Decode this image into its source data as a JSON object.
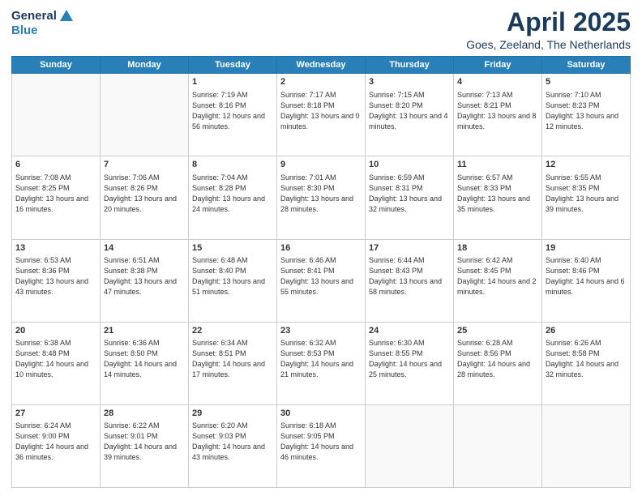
{
  "header": {
    "logo_general": "General",
    "logo_blue": "Blue",
    "title": "April 2025",
    "location": "Goes, Zeeland, The Netherlands"
  },
  "weekdays": [
    "Sunday",
    "Monday",
    "Tuesday",
    "Wednesday",
    "Thursday",
    "Friday",
    "Saturday"
  ],
  "weeks": [
    [
      {
        "day": "",
        "sunrise": "",
        "sunset": "",
        "daylight": "",
        "empty": true
      },
      {
        "day": "",
        "sunrise": "",
        "sunset": "",
        "daylight": "",
        "empty": true
      },
      {
        "day": "1",
        "sunrise": "Sunrise: 7:19 AM",
        "sunset": "Sunset: 8:16 PM",
        "daylight": "Daylight: 12 hours and 56 minutes.",
        "empty": false
      },
      {
        "day": "2",
        "sunrise": "Sunrise: 7:17 AM",
        "sunset": "Sunset: 8:18 PM",
        "daylight": "Daylight: 13 hours and 0 minutes.",
        "empty": false
      },
      {
        "day": "3",
        "sunrise": "Sunrise: 7:15 AM",
        "sunset": "Sunset: 8:20 PM",
        "daylight": "Daylight: 13 hours and 4 minutes.",
        "empty": false
      },
      {
        "day": "4",
        "sunrise": "Sunrise: 7:13 AM",
        "sunset": "Sunset: 8:21 PM",
        "daylight": "Daylight: 13 hours and 8 minutes.",
        "empty": false
      },
      {
        "day": "5",
        "sunrise": "Sunrise: 7:10 AM",
        "sunset": "Sunset: 8:23 PM",
        "daylight": "Daylight: 13 hours and 12 minutes.",
        "empty": false
      }
    ],
    [
      {
        "day": "6",
        "sunrise": "Sunrise: 7:08 AM",
        "sunset": "Sunset: 8:25 PM",
        "daylight": "Daylight: 13 hours and 16 minutes.",
        "empty": false
      },
      {
        "day": "7",
        "sunrise": "Sunrise: 7:06 AM",
        "sunset": "Sunset: 8:26 PM",
        "daylight": "Daylight: 13 hours and 20 minutes.",
        "empty": false
      },
      {
        "day": "8",
        "sunrise": "Sunrise: 7:04 AM",
        "sunset": "Sunset: 8:28 PM",
        "daylight": "Daylight: 13 hours and 24 minutes.",
        "empty": false
      },
      {
        "day": "9",
        "sunrise": "Sunrise: 7:01 AM",
        "sunset": "Sunset: 8:30 PM",
        "daylight": "Daylight: 13 hours and 28 minutes.",
        "empty": false
      },
      {
        "day": "10",
        "sunrise": "Sunrise: 6:59 AM",
        "sunset": "Sunset: 8:31 PM",
        "daylight": "Daylight: 13 hours and 32 minutes.",
        "empty": false
      },
      {
        "day": "11",
        "sunrise": "Sunrise: 6:57 AM",
        "sunset": "Sunset: 8:33 PM",
        "daylight": "Daylight: 13 hours and 35 minutes.",
        "empty": false
      },
      {
        "day": "12",
        "sunrise": "Sunrise: 6:55 AM",
        "sunset": "Sunset: 8:35 PM",
        "daylight": "Daylight: 13 hours and 39 minutes.",
        "empty": false
      }
    ],
    [
      {
        "day": "13",
        "sunrise": "Sunrise: 6:53 AM",
        "sunset": "Sunset: 8:36 PM",
        "daylight": "Daylight: 13 hours and 43 minutes.",
        "empty": false
      },
      {
        "day": "14",
        "sunrise": "Sunrise: 6:51 AM",
        "sunset": "Sunset: 8:38 PM",
        "daylight": "Daylight: 13 hours and 47 minutes.",
        "empty": false
      },
      {
        "day": "15",
        "sunrise": "Sunrise: 6:48 AM",
        "sunset": "Sunset: 8:40 PM",
        "daylight": "Daylight: 13 hours and 51 minutes.",
        "empty": false
      },
      {
        "day": "16",
        "sunrise": "Sunrise: 6:46 AM",
        "sunset": "Sunset: 8:41 PM",
        "daylight": "Daylight: 13 hours and 55 minutes.",
        "empty": false
      },
      {
        "day": "17",
        "sunrise": "Sunrise: 6:44 AM",
        "sunset": "Sunset: 8:43 PM",
        "daylight": "Daylight: 13 hours and 58 minutes.",
        "empty": false
      },
      {
        "day": "18",
        "sunrise": "Sunrise: 6:42 AM",
        "sunset": "Sunset: 8:45 PM",
        "daylight": "Daylight: 14 hours and 2 minutes.",
        "empty": false
      },
      {
        "day": "19",
        "sunrise": "Sunrise: 6:40 AM",
        "sunset": "Sunset: 8:46 PM",
        "daylight": "Daylight: 14 hours and 6 minutes.",
        "empty": false
      }
    ],
    [
      {
        "day": "20",
        "sunrise": "Sunrise: 6:38 AM",
        "sunset": "Sunset: 8:48 PM",
        "daylight": "Daylight: 14 hours and 10 minutes.",
        "empty": false
      },
      {
        "day": "21",
        "sunrise": "Sunrise: 6:36 AM",
        "sunset": "Sunset: 8:50 PM",
        "daylight": "Daylight: 14 hours and 14 minutes.",
        "empty": false
      },
      {
        "day": "22",
        "sunrise": "Sunrise: 6:34 AM",
        "sunset": "Sunset: 8:51 PM",
        "daylight": "Daylight: 14 hours and 17 minutes.",
        "empty": false
      },
      {
        "day": "23",
        "sunrise": "Sunrise: 6:32 AM",
        "sunset": "Sunset: 8:53 PM",
        "daylight": "Daylight: 14 hours and 21 minutes.",
        "empty": false
      },
      {
        "day": "24",
        "sunrise": "Sunrise: 6:30 AM",
        "sunset": "Sunset: 8:55 PM",
        "daylight": "Daylight: 14 hours and 25 minutes.",
        "empty": false
      },
      {
        "day": "25",
        "sunrise": "Sunrise: 6:28 AM",
        "sunset": "Sunset: 8:56 PM",
        "daylight": "Daylight: 14 hours and 28 minutes.",
        "empty": false
      },
      {
        "day": "26",
        "sunrise": "Sunrise: 6:26 AM",
        "sunset": "Sunset: 8:58 PM",
        "daylight": "Daylight: 14 hours and 32 minutes.",
        "empty": false
      }
    ],
    [
      {
        "day": "27",
        "sunrise": "Sunrise: 6:24 AM",
        "sunset": "Sunset: 9:00 PM",
        "daylight": "Daylight: 14 hours and 36 minutes.",
        "empty": false
      },
      {
        "day": "28",
        "sunrise": "Sunrise: 6:22 AM",
        "sunset": "Sunset: 9:01 PM",
        "daylight": "Daylight: 14 hours and 39 minutes.",
        "empty": false
      },
      {
        "day": "29",
        "sunrise": "Sunrise: 6:20 AM",
        "sunset": "Sunset: 9:03 PM",
        "daylight": "Daylight: 14 hours and 43 minutes.",
        "empty": false
      },
      {
        "day": "30",
        "sunrise": "Sunrise: 6:18 AM",
        "sunset": "Sunset: 9:05 PM",
        "daylight": "Daylight: 14 hours and 46 minutes.",
        "empty": false
      },
      {
        "day": "",
        "sunrise": "",
        "sunset": "",
        "daylight": "",
        "empty": true
      },
      {
        "day": "",
        "sunrise": "",
        "sunset": "",
        "daylight": "",
        "empty": true
      },
      {
        "day": "",
        "sunrise": "",
        "sunset": "",
        "daylight": "",
        "empty": true
      }
    ]
  ]
}
